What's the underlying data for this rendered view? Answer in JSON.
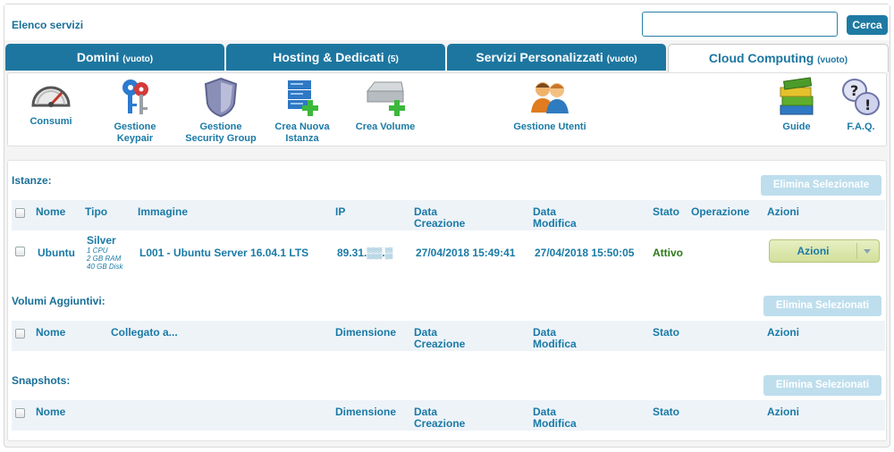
{
  "header": {
    "title": "Elenco servizi",
    "search_value": "",
    "search_button": "Cerca"
  },
  "tabs": [
    {
      "label": "Domini",
      "count": "(vuoto)"
    },
    {
      "label": "Hosting & Dedicati",
      "count": "(5)"
    },
    {
      "label": "Servizi Personalizzati",
      "count": "(vuoto)"
    },
    {
      "label": "Cloud Computing",
      "count": "(vuoto)"
    }
  ],
  "toolbar": {
    "consumi": "Consumi",
    "keypair": [
      "Gestione",
      "Keypair"
    ],
    "security": [
      "Gestione",
      "Security Group"
    ],
    "nuova_istanza": [
      "Crea Nuova",
      "Istanza"
    ],
    "crea_volume": "Crea Volume",
    "gestione_utenti": "Gestione Utenti",
    "guide": "Guide",
    "faq": "F.A.Q."
  },
  "istanze": {
    "title": "Istanze:",
    "delete_button": "Elimina Selezionate",
    "columns": {
      "nome": "Nome",
      "tipo": "Tipo",
      "immagine": "Immagine",
      "ip": "IP",
      "data_creazione": [
        "Data",
        "Creazione"
      ],
      "data_modifica": [
        "Data",
        "Modifica"
      ],
      "stato": "Stato",
      "operazione": "Operazione",
      "azioni": "Azioni"
    },
    "rows": [
      {
        "nome": "Ubuntu",
        "tipo": "Silver",
        "tipo_details": [
          "1 CPU",
          "2 GB RAM",
          "40 GB Disk"
        ],
        "immagine": "L001 - Ubuntu Server 16.04.1 LTS",
        "ip": "89.31.▒▒.▒",
        "data_creazione": "27/04/2018 15:49:41",
        "data_modifica": "27/04/2018 15:50:05",
        "stato": "Attivo",
        "azioni": "Azioni"
      }
    ]
  },
  "volumi": {
    "title": "Volumi Aggiuntivi:",
    "delete_button": "Elimina Selezionati",
    "columns": {
      "nome": "Nome",
      "collegato": "Collegato a...",
      "dimensione": "Dimensione",
      "data_creazione": [
        "Data",
        "Creazione"
      ],
      "data_modifica": [
        "Data",
        "Modifica"
      ],
      "stato": "Stato",
      "azioni": "Azioni"
    }
  },
  "snapshots": {
    "title": "Snapshots:",
    "delete_button": "Elimina Selezionati",
    "columns": {
      "nome": "Nome",
      "dimensione": "Dimensione",
      "data_creazione": [
        "Data",
        "Creazione"
      ],
      "data_modifica": [
        "Data",
        "Modifica"
      ],
      "stato": "Stato",
      "azioni": "Azioni"
    }
  },
  "colors": {
    "primary": "#1d76a0",
    "text": "#1a7aa6",
    "status_active": "#2c7a19",
    "disabled_button": "#bedeed",
    "action_button": "#d2e09a"
  }
}
